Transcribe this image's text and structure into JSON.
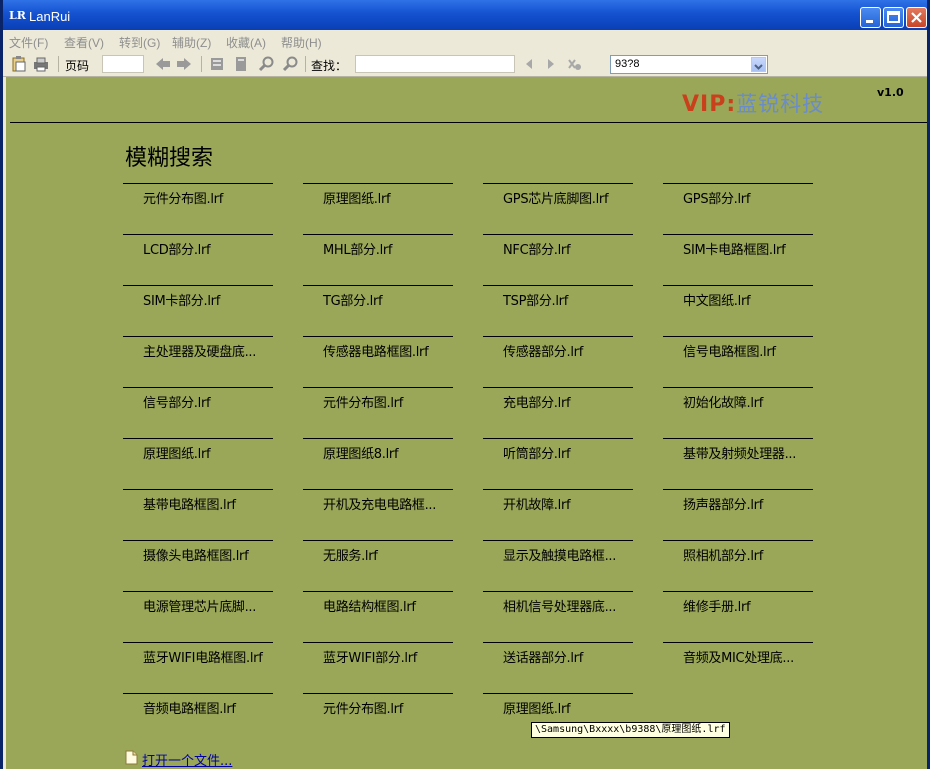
{
  "window": {
    "logo": "LR",
    "title": "LanRui"
  },
  "menu": [
    "文件(F)",
    "查看(V)",
    "转到(G)",
    "辅助(Z)",
    "收藏(A)",
    "帮助(H)"
  ],
  "toolbar": {
    "page_label": "页码",
    "find_label": "查找：",
    "combo_value": "93?8"
  },
  "header": {
    "brand_vip": "VIP:",
    "brand_name": "蓝锐科技",
    "version": "v1.0"
  },
  "section_title": "模糊搜索",
  "files": [
    "元件分布图.lrf",
    "原理图纸.lrf",
    "GPS芯片底脚图.lrf",
    "GPS部分.lrf",
    "LCD部分.lrf",
    "MHL部分.lrf",
    "NFC部分.lrf",
    "SIM卡电路框图.lrf",
    "SIM卡部分.lrf",
    "TG部分.lrf",
    "TSP部分.lrf",
    "中文图纸.lrf",
    "主处理器及硬盘底...",
    "传感器电路框图.lrf",
    "传感器部分.lrf",
    "信号电路框图.lrf",
    "信号部分.lrf",
    "元件分布图.lrf",
    "充电部分.lrf",
    "初始化故障.lrf",
    "原理图纸.lrf",
    "原理图纸8.lrf",
    "听筒部分.lrf",
    "基带及射频处理器...",
    "基带电路框图.lrf",
    "开机及充电电路框...",
    "开机故障.lrf",
    "扬声器部分.lrf",
    "摄像头电路框图.lrf",
    "无服务.lrf",
    "显示及触摸电路框...",
    "照相机部分.lrf",
    "电源管理芯片底脚...",
    "电路结构框图.lrf",
    "相机信号处理器底...",
    "维修手册.lrf",
    "蓝牙WIFI电路框图.lrf",
    "蓝牙WIFI部分.lrf",
    "送话器部分.lrf",
    "音频及MIC处理底...",
    "音频电路框图.lrf",
    "元件分布图.lrf",
    "原理图纸.lrf"
  ],
  "open_file_link": "打开一个文件...",
  "tooltip": "\\Samsung\\Bxxxx\\b9388\\原理图纸.lrf"
}
